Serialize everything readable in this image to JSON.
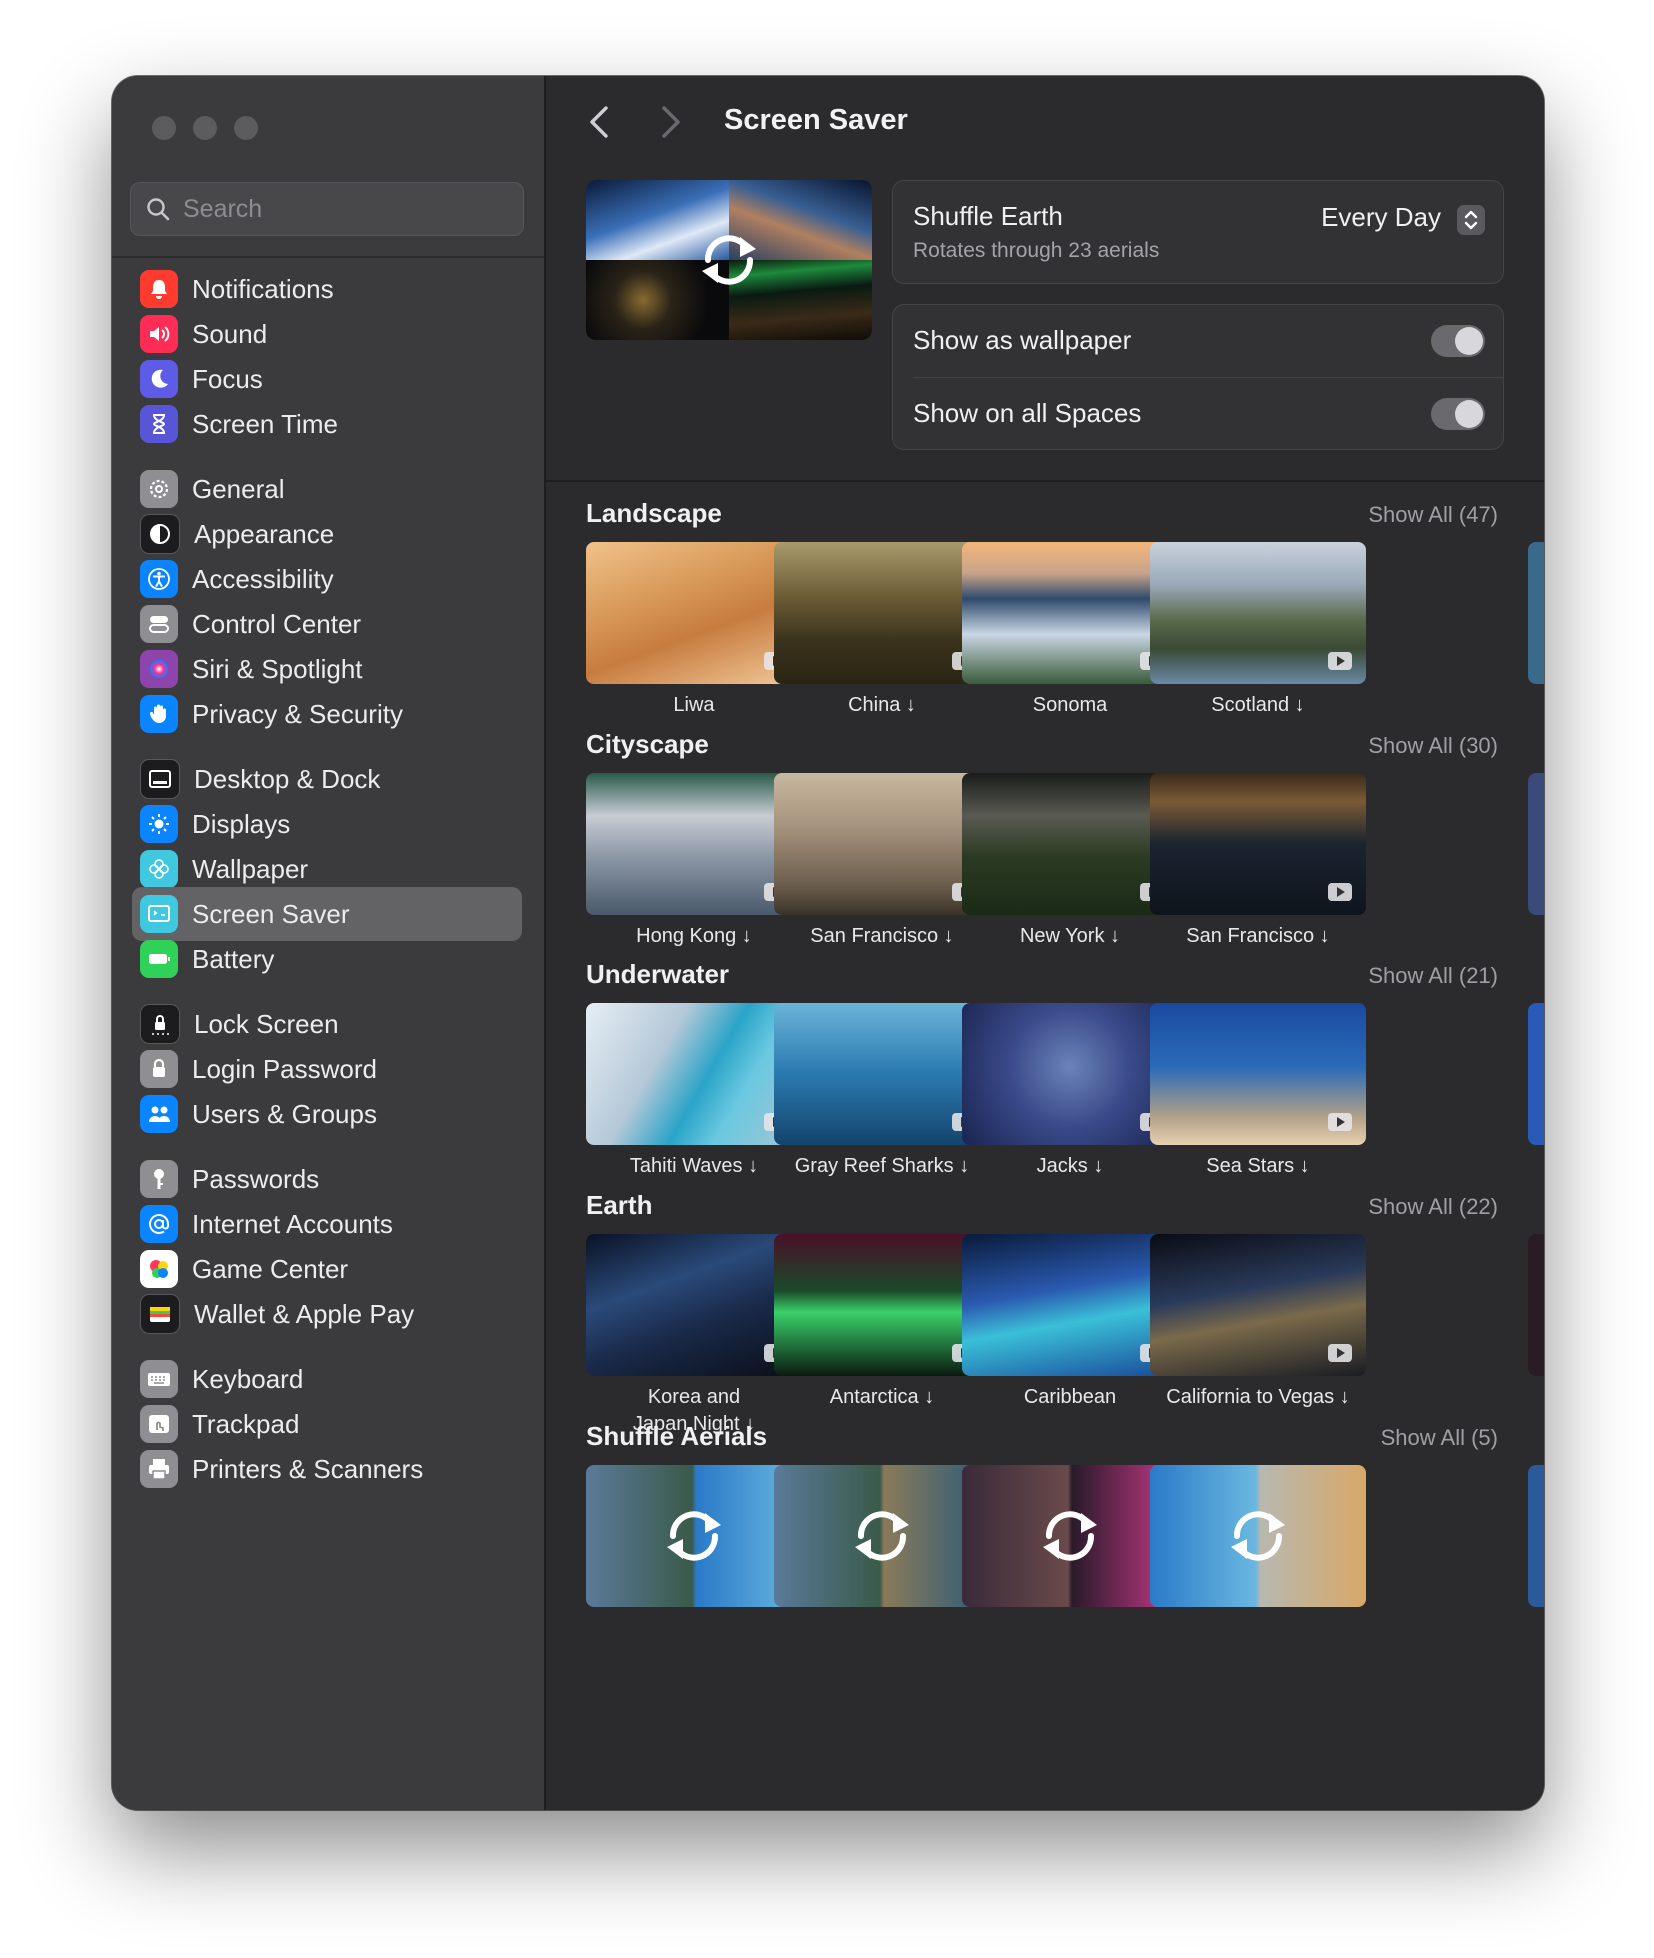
{
  "window": {
    "title": "Screen Saver"
  },
  "search": {
    "placeholder": "Search"
  },
  "sidebar": {
    "items": [
      {
        "label": "Notifications",
        "icon": "bell-icon",
        "color": "#ff3b30"
      },
      {
        "label": "Sound",
        "icon": "speaker-icon",
        "color": "#ff2d55"
      },
      {
        "label": "Focus",
        "icon": "moon-icon",
        "color": "#5e5ce6"
      },
      {
        "label": "Screen Time",
        "icon": "hourglass-icon",
        "color": "#5856d6"
      },
      {
        "label": "General",
        "icon": "gear-icon",
        "color": "#8e8e93"
      },
      {
        "label": "Appearance",
        "icon": "circle-half-icon",
        "color": "#1c1c1e"
      },
      {
        "label": "Accessibility",
        "icon": "accessibility-icon",
        "color": "#0a84ff"
      },
      {
        "label": "Control Center",
        "icon": "switches-icon",
        "color": "#8e8e93"
      },
      {
        "label": "Siri & Spotlight",
        "icon": "siri-icon",
        "color": "#8e44ad"
      },
      {
        "label": "Privacy & Security",
        "icon": "hand-icon",
        "color": "#0a84ff"
      },
      {
        "label": "Desktop & Dock",
        "icon": "dock-icon",
        "color": "#1c1c1e"
      },
      {
        "label": "Displays",
        "icon": "sun-icon",
        "color": "#0a84ff"
      },
      {
        "label": "Wallpaper",
        "icon": "flower-icon",
        "color": "#40c8e0"
      },
      {
        "label": "Screen Saver",
        "icon": "screen-saver-icon",
        "color": "#40c8e0"
      },
      {
        "label": "Battery",
        "icon": "battery-icon",
        "color": "#30d158"
      },
      {
        "label": "Lock Screen",
        "icon": "lock-screen-icon",
        "color": "#1c1c1e"
      },
      {
        "label": "Login Password",
        "icon": "lock-icon",
        "color": "#8e8e93"
      },
      {
        "label": "Users & Groups",
        "icon": "users-icon",
        "color": "#0a84ff"
      },
      {
        "label": "Passwords",
        "icon": "key-icon",
        "color": "#8e8e93"
      },
      {
        "label": "Internet Accounts",
        "icon": "at-icon",
        "color": "#0a84ff"
      },
      {
        "label": "Game Center",
        "icon": "game-center-icon",
        "color": "#ffffff"
      },
      {
        "label": "Wallet & Apple Pay",
        "icon": "wallet-icon",
        "color": "#1c1c1e"
      },
      {
        "label": "Keyboard",
        "icon": "keyboard-icon",
        "color": "#8e8e93"
      },
      {
        "label": "Trackpad",
        "icon": "trackpad-icon",
        "color": "#8e8e93"
      },
      {
        "label": "Printers & Scanners",
        "icon": "printer-icon",
        "color": "#8e8e93"
      }
    ],
    "selected": "Screen Saver"
  },
  "current": {
    "title": "Shuffle Earth",
    "subtitle": "Rotates through 23 aerials",
    "frequency": "Every Day"
  },
  "toggles": [
    {
      "label": "Show as wallpaper",
      "on": true
    },
    {
      "label": "Show on all Spaces",
      "on": true
    }
  ],
  "sections": [
    {
      "title": "Landscape",
      "show_all": "Show All (47)",
      "items": [
        {
          "caption": "Liwa"
        },
        {
          "caption": "China ↓"
        },
        {
          "caption": "Sonoma"
        },
        {
          "caption": "Scotland ↓"
        }
      ]
    },
    {
      "title": "Cityscape",
      "show_all": "Show All (30)",
      "items": [
        {
          "caption": "Hong Kong ↓"
        },
        {
          "caption": "San Francisco ↓"
        },
        {
          "caption": "New York ↓"
        },
        {
          "caption": "San Francisco ↓"
        }
      ]
    },
    {
      "title": "Underwater",
      "show_all": "Show All (21)",
      "items": [
        {
          "caption": "Tahiti Waves ↓"
        },
        {
          "caption": "Gray Reef Sharks ↓"
        },
        {
          "caption": "Jacks ↓"
        },
        {
          "caption": "Sea Stars ↓"
        }
      ]
    },
    {
      "title": "Earth",
      "show_all": "Show All (22)",
      "items": [
        {
          "caption": "Korea and\nJapan Night ↓"
        },
        {
          "caption": "Antarctica ↓"
        },
        {
          "caption": "Caribbean"
        },
        {
          "caption": "California to Vegas ↓"
        }
      ]
    },
    {
      "title": "Shuffle Aerials",
      "show_all": "Show All (5)",
      "items": [
        {
          "caption": ""
        },
        {
          "caption": ""
        },
        {
          "caption": ""
        },
        {
          "caption": ""
        }
      ]
    }
  ]
}
